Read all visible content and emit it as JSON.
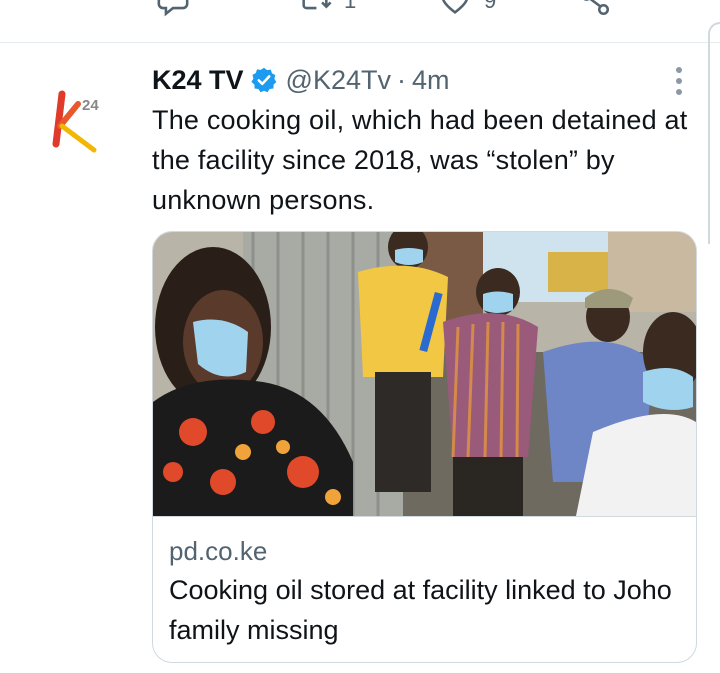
{
  "previous_tweet": {
    "retweet_count": "1",
    "like_count": "9",
    "icons": [
      "reply-icon",
      "retweet-icon",
      "like-icon",
      "share-icon"
    ]
  },
  "tweet": {
    "display_name": "K24 TV",
    "handle": "@K24Tv",
    "separator": "·",
    "time": "4m",
    "text": "The cooking oil, which had been detained at the facility since 2018, was “stolen” by unknown persons.",
    "avatar_logo": {
      "letter": "K",
      "superscript": "24"
    },
    "card": {
      "domain": "pd.co.ke",
      "title": "Cooking oil stored at facility linked to Joho family missing"
    }
  },
  "colors": {
    "verified": "#1d9bf0",
    "muted_text": "#536471",
    "logo_red": "#e03a2a",
    "logo_yellow": "#f2b705"
  }
}
